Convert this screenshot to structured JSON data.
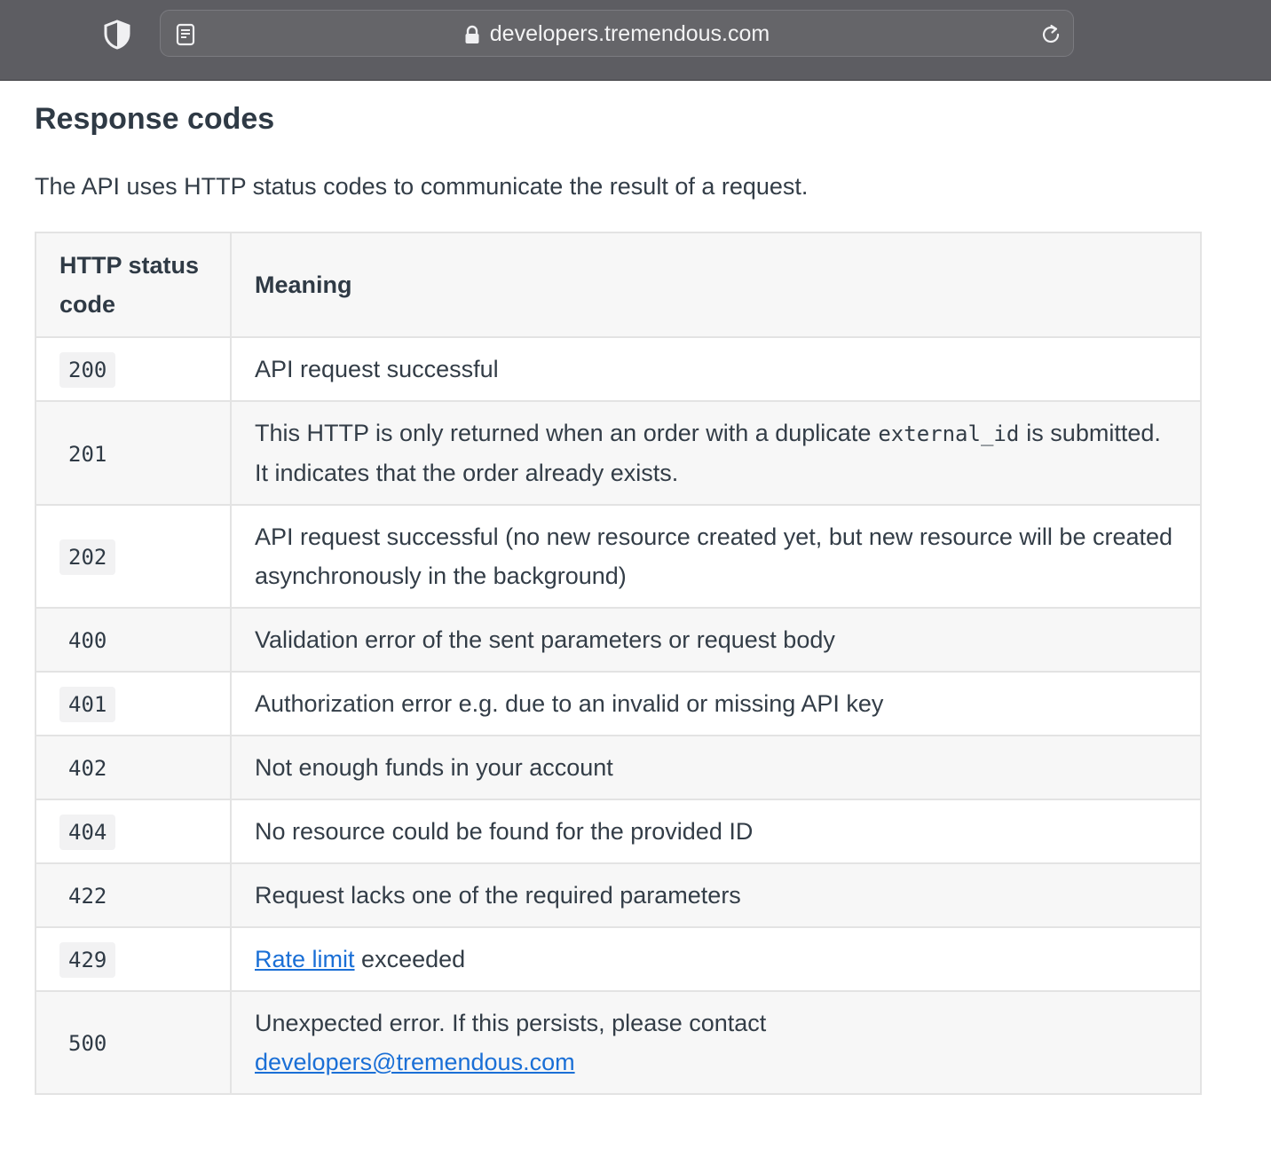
{
  "browser": {
    "url": "developers.tremendous.com"
  },
  "page": {
    "title": "Response codes",
    "intro": "The API uses HTTP status codes to communicate the result of a request."
  },
  "table": {
    "headers": [
      "HTTP status code",
      "Meaning"
    ],
    "rows": [
      {
        "code": "200",
        "meaning": "API request successful"
      },
      {
        "code": "201",
        "meaning_before": "This HTTP is only returned when an order with a duplicate",
        "meaning_code": "external_id",
        "meaning_after": "is submitted. It indicates that the order already exists."
      },
      {
        "code": "202",
        "meaning": "API request successful (no new resource created yet, but new resource will be created asynchronously in the background)"
      },
      {
        "code": "400",
        "meaning": "Validation error of the sent parameters or request body"
      },
      {
        "code": "401",
        "meaning": "Authorization error e.g. due to an invalid or missing API key"
      },
      {
        "code": "402",
        "meaning": "Not enough funds in your account"
      },
      {
        "code": "404",
        "meaning": "No resource could be found for the provided ID"
      },
      {
        "code": "422",
        "meaning": "Request lacks one of the required parameters"
      },
      {
        "code": "429",
        "meaning_link": "Rate limit",
        "meaning_after": "exceeded"
      },
      {
        "code": "500",
        "meaning_before": "Unexpected error. If this persists, please contact",
        "meaning_link": "developers@tremendous.com"
      }
    ]
  },
  "colors": {
    "toolbar": "#5d5d62",
    "link": "#1a6fd6",
    "text": "#333d47",
    "row_alt": "#f7f7f7",
    "border": "#e3e3e3"
  }
}
